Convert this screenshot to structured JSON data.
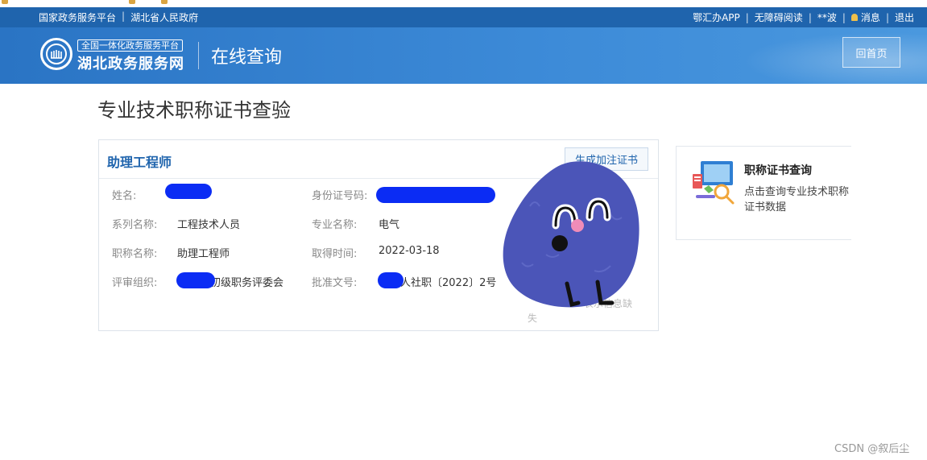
{
  "topbar": {
    "left_links": [
      "国家政务服务平台",
      "湖北省人民政府"
    ],
    "right_links": [
      "鄂汇办APP",
      "无障碍阅读",
      "**波",
      "消息",
      "退出"
    ]
  },
  "header": {
    "logo_sub": "全国一体化政务服务平台",
    "logo_main": "湖北政务服务网",
    "title": "在线查询",
    "home_button": "回首页"
  },
  "page": {
    "title": "专业技术职称证书查验"
  },
  "card": {
    "title": "助理工程师",
    "generate_button": "生成加注证书",
    "fields": {
      "name_label": "姓名:",
      "id_label": "身份证号码:",
      "series_label": "系列名称:",
      "series_value": "工程技术人员",
      "major_label": "专业名称:",
      "major_value": "电气",
      "title_label": "职称名称:",
      "title_value": "助理工程师",
      "date_label": "取得时间:",
      "date_value": "2022-03-18",
      "org_label": "评审组织:",
      "org_value": "初级职务评委会",
      "approval_label": "批准文号:",
      "approval_value": "人社职〔2022〕2号"
    },
    "faded_note_1": "表示信息缺",
    "faded_note_2": "失"
  },
  "side_card": {
    "title": "职称证书查询",
    "desc": "点击查询专业技术职称证书数据"
  },
  "watermark": "CSDN @叙后尘",
  "colors": {
    "brand_blue": "#1f64ad",
    "redaction": "#0b2cf4",
    "blob": "#4b55b8"
  }
}
